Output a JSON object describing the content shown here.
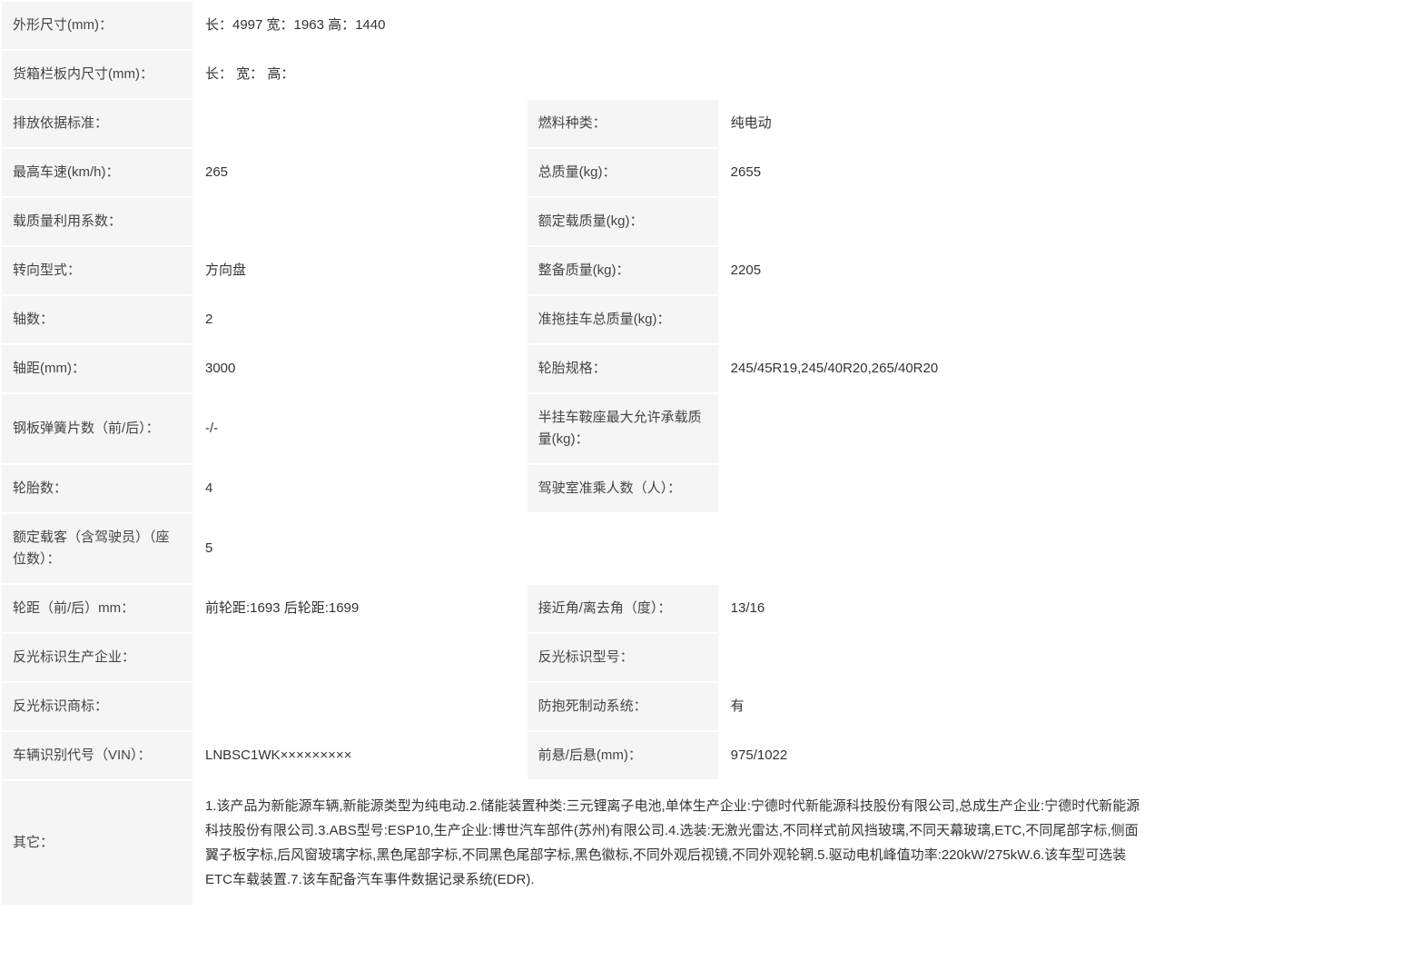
{
  "labels": {
    "dimensions": "外形尺寸(mm)：",
    "cargo_dimensions": "货箱栏板内尺寸(mm)：",
    "emission_standard": "排放依据标准：",
    "fuel_type": "燃料种类：",
    "max_speed": "最高车速(km/h)：",
    "total_mass": "总质量(kg)：",
    "load_factor": "载质量利用系数：",
    "rated_load": "额定载质量(kg)：",
    "steering_type": "转向型式：",
    "curb_weight": "整备质量(kg)：",
    "axle_count": "轴数：",
    "trailer_mass": "准拖挂车总质量(kg)：",
    "wheelbase": "轴距(mm)：",
    "tire_spec": "轮胎规格：",
    "leaf_spring": "钢板弹簧片数（前/后）：",
    "saddle_load": "半挂车鞍座最大允许承载质量(kg)：",
    "tire_count": "轮胎数：",
    "cab_capacity": "驾驶室准乘人数（人）：",
    "rated_passengers": "额定载客（含驾驶员）（座位数）：",
    "track_width": "轮距（前/后）mm：",
    "approach_angle": "接近角/离去角（度）：",
    "reflector_maker": "反光标识生产企业：",
    "reflector_model": "反光标识型号：",
    "reflector_brand": "反光标识商标：",
    "abs": "防抱死制动系统：",
    "vin": "车辆识别代号（VIN）：",
    "overhang": "前悬/后悬(mm)：",
    "other": "其它："
  },
  "values": {
    "dimensions": "长：4997 宽：1963 高：1440",
    "cargo_dimensions": "长： 宽： 高：",
    "emission_standard": "",
    "fuel_type": "纯电动",
    "max_speed": "265",
    "total_mass": "2655",
    "load_factor": "",
    "rated_load": "",
    "steering_type": "方向盘",
    "curb_weight": "2205",
    "axle_count": "2",
    "trailer_mass": "",
    "wheelbase": "3000",
    "tire_spec": "245/45R19,245/40R20,265/40R20",
    "leaf_spring": "-/-",
    "saddle_load": "",
    "tire_count": "4",
    "cab_capacity": "",
    "rated_passengers": "5",
    "track_width": "前轮距:1693 后轮距:1699",
    "approach_angle": "13/16",
    "reflector_maker": "",
    "reflector_model": "",
    "reflector_brand": "",
    "abs": "有",
    "vin": "LNBSC1WK×××××××××",
    "overhang": "975/1022",
    "other": "1.该产品为新能源车辆,新能源类型为纯电动.2.储能装置种类:三元锂离子电池,单体生产企业:宁德时代新能源科技股份有限公司,总成生产企业:宁德时代新能源科技股份有限公司.3.ABS型号:ESP10,生产企业:博世汽车部件(苏州)有限公司.4.选装:无激光雷达,不同样式前风挡玻璃,不同天幕玻璃,ETC,不同尾部字标,侧面翼子板字标,后风窗玻璃字标,黑色尾部字标,不同黑色尾部字标,黑色徽标,不同外观后视镜,不同外观轮辋.5.驱动电机峰值功率:220kW/275kW.6.该车型可选装ETC车载装置.7.该车配备汽车事件数据记录系统(EDR)."
  }
}
